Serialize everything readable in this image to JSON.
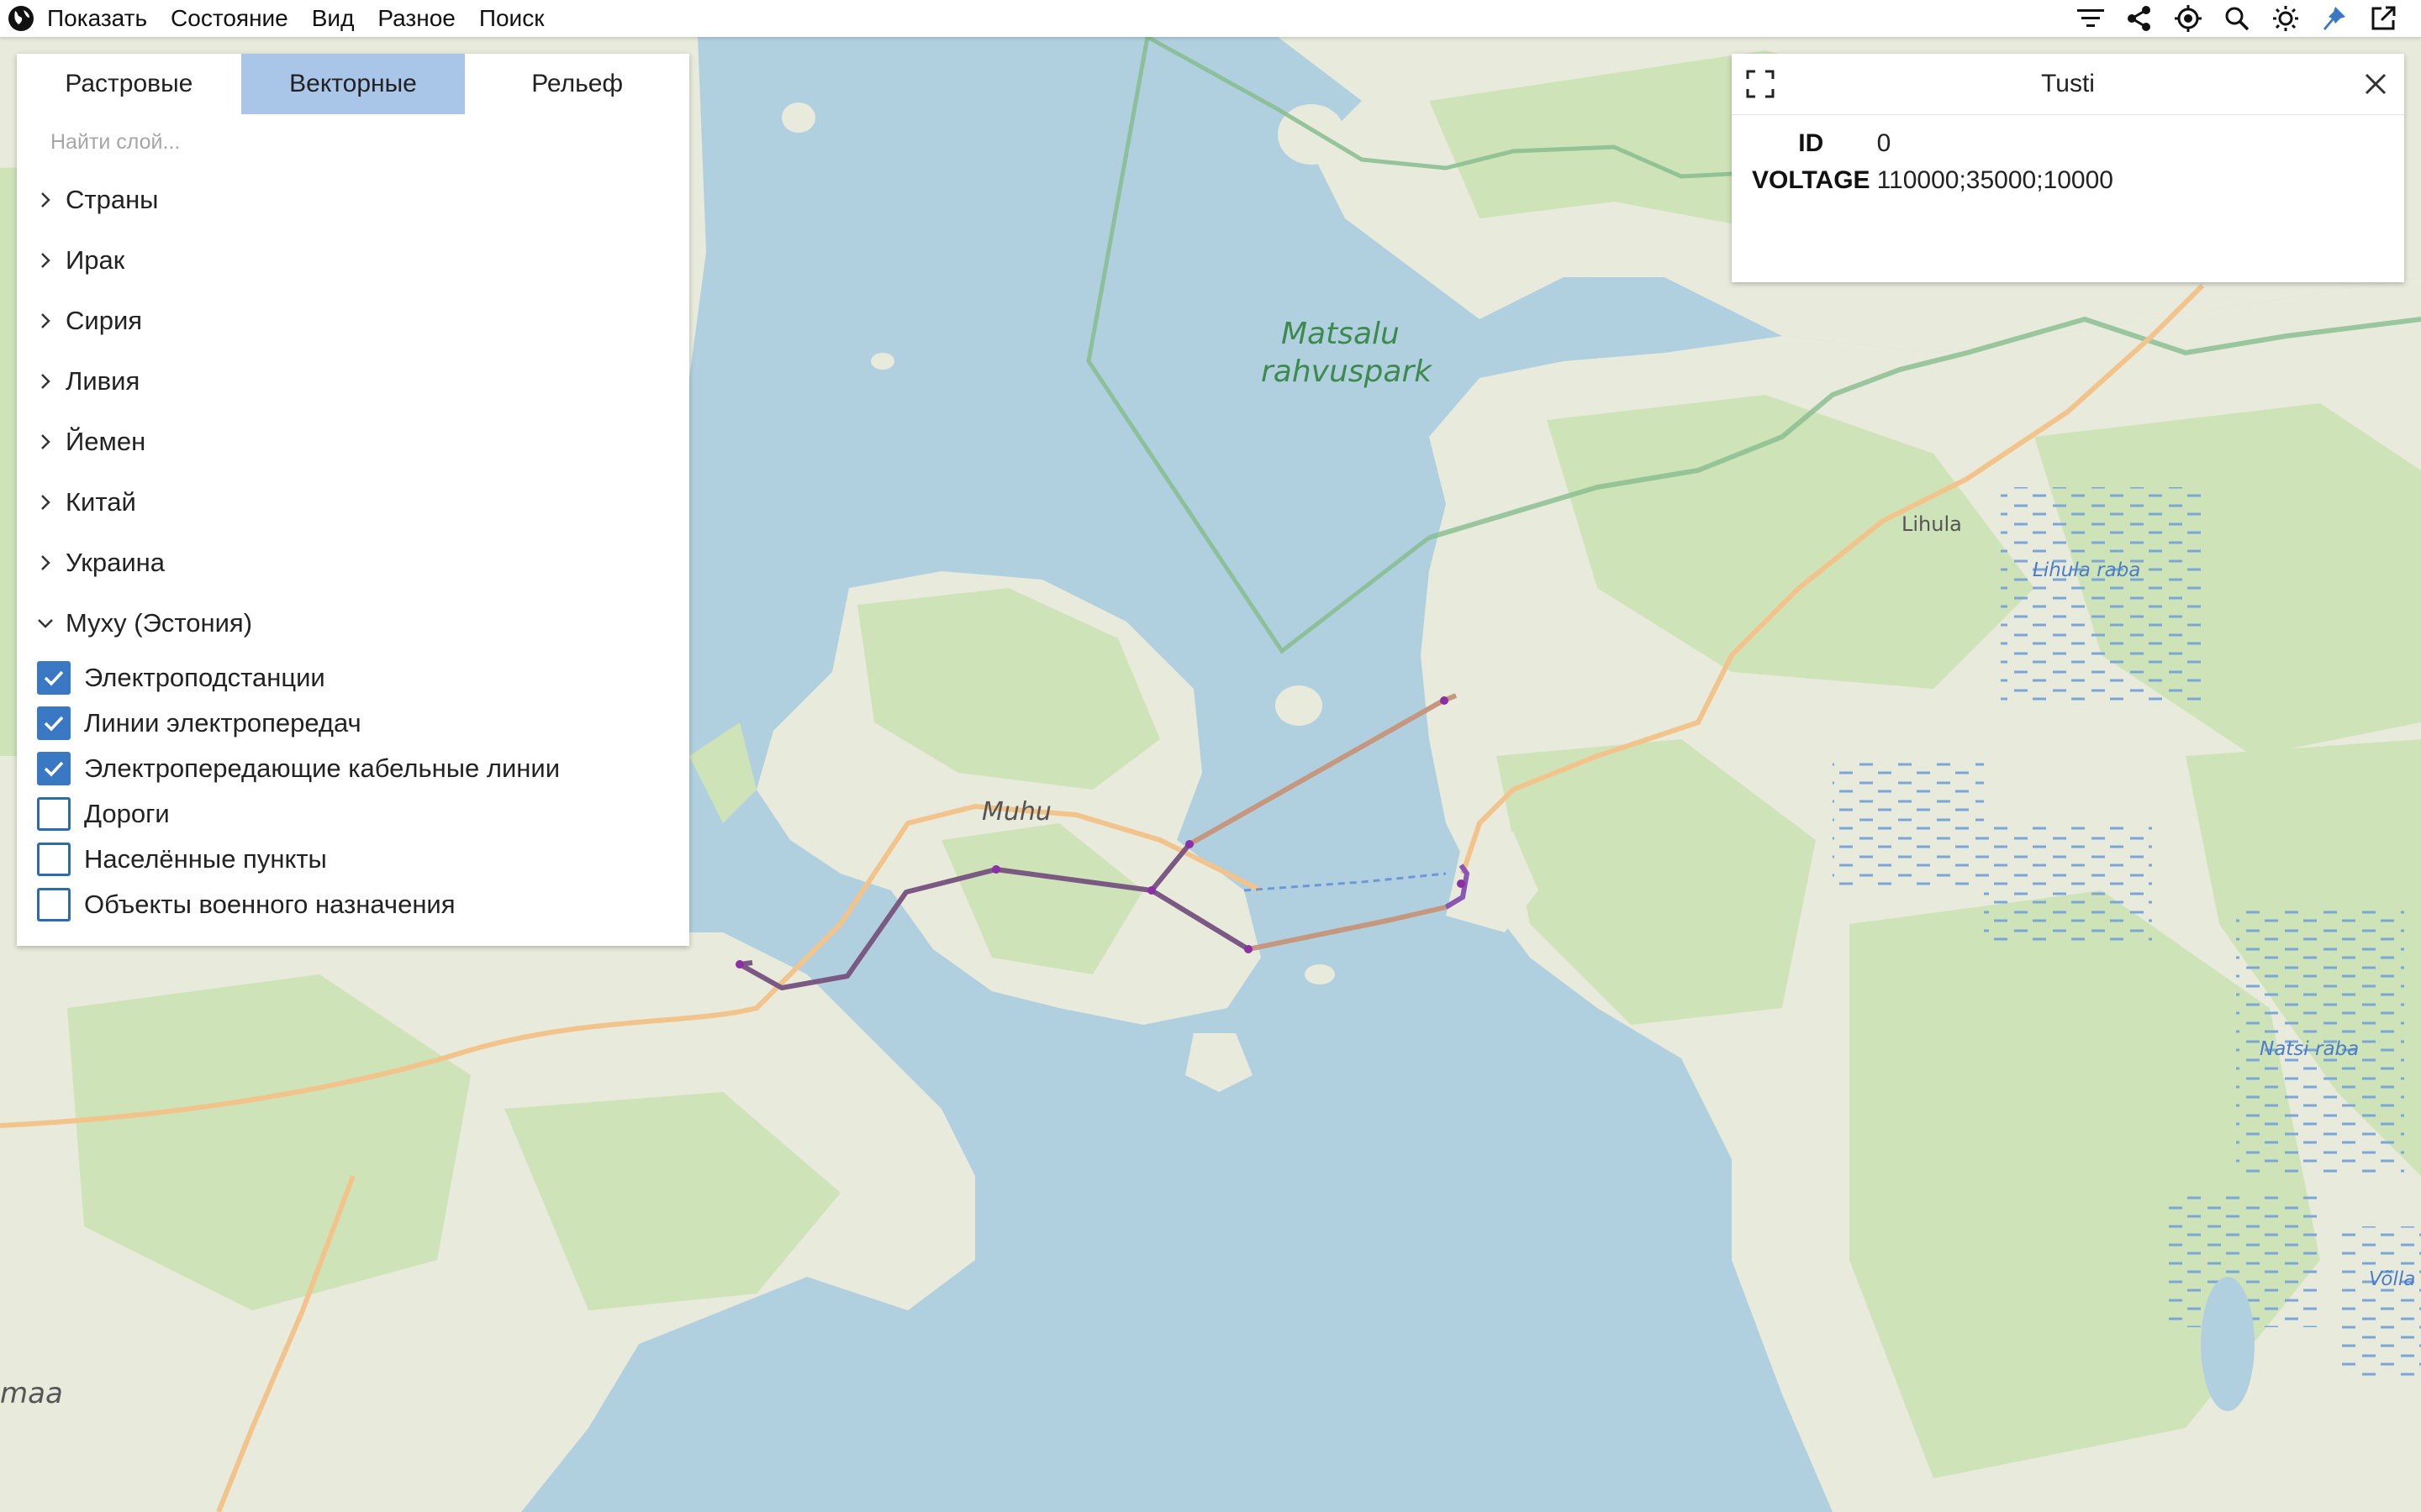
{
  "app": {
    "menu": [
      "Показать",
      "Состояние",
      "Вид",
      "Разное",
      "Поиск"
    ],
    "toolbar_icons": [
      "filter-icon",
      "share-icon",
      "locate-icon",
      "search-icon",
      "brightness-icon",
      "pin-icon",
      "external-link-icon"
    ]
  },
  "layer_panel": {
    "tabs": [
      {
        "label": "Растровые",
        "active": false
      },
      {
        "label": "Векторные",
        "active": true
      },
      {
        "label": "Рельеф",
        "active": false
      }
    ],
    "search_placeholder": "Найти слой...",
    "groups": [
      {
        "label": "Страны",
        "expanded": false
      },
      {
        "label": "Ирак",
        "expanded": false
      },
      {
        "label": "Сирия",
        "expanded": false
      },
      {
        "label": "Ливия",
        "expanded": false
      },
      {
        "label": "Йемен",
        "expanded": false
      },
      {
        "label": "Китай",
        "expanded": false
      },
      {
        "label": "Украина",
        "expanded": false
      },
      {
        "label": "Муху (Эстония)",
        "expanded": true
      }
    ],
    "layers": [
      {
        "label": "Электроподстанции",
        "checked": true
      },
      {
        "label": "Линии электропередач",
        "checked": true
      },
      {
        "label": "Электропередающие кабельные линии",
        "checked": true
      },
      {
        "label": "Дороги",
        "checked": false
      },
      {
        "label": "Населённые пункты",
        "checked": false
      },
      {
        "label": "Объекты военного назначения",
        "checked": false
      }
    ]
  },
  "feature_popup": {
    "title": "Tusti",
    "attributes": [
      {
        "key": "ID",
        "value": "0"
      },
      {
        "key": "VOLTAGE",
        "value": "110000;35000;10000"
      }
    ]
  },
  "map": {
    "labels": {
      "matsalu_1": "Matsalu",
      "matsalu_2": "rahvuspark",
      "muhu": "Muhu",
      "lihula": "Lihula",
      "lihula_raba": "Lihula raba",
      "natsi_raba": "Natsi raba",
      "volla": "Võlla",
      "maa": "maa"
    },
    "colors": {
      "water": "#b1d0df",
      "land": "#e8eadc",
      "forest": "#cfe3b9",
      "park_boundary": "#86bd8e",
      "road": "#f2c48c",
      "power_line": "#7a5a82",
      "cable_line": "#c5977f",
      "substation": "#8a2fa4"
    }
  }
}
